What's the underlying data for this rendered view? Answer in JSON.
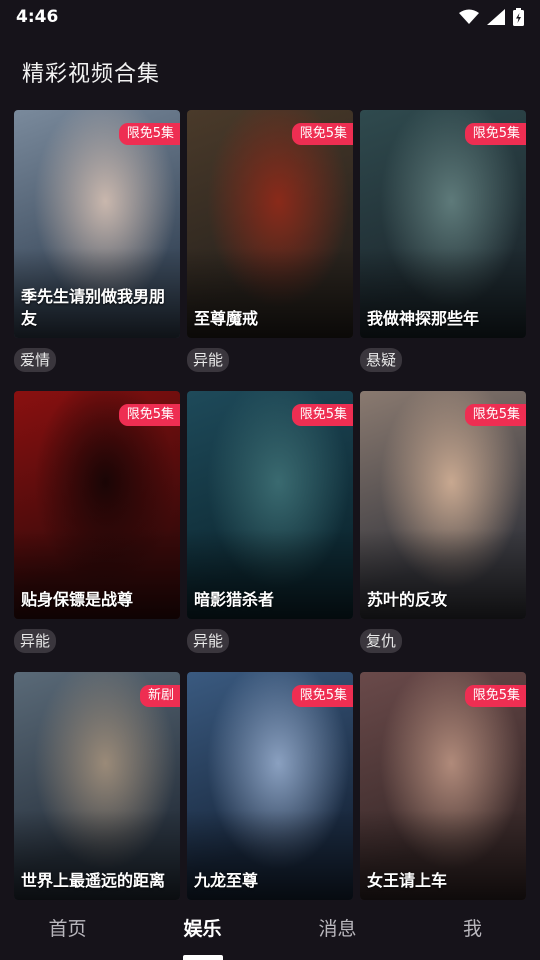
{
  "status": {
    "time": "4:46",
    "icons": [
      "wifi-icon",
      "signal-icon",
      "battery-icon"
    ]
  },
  "section": {
    "title": "精彩视频合集"
  },
  "cards": [
    {
      "title": "季先生请别做我男朋友",
      "badge": "限免5集",
      "genre": "爱情",
      "palette": [
        "#3b4a5c",
        "#7a8a9c",
        "#c9b7ad"
      ]
    },
    {
      "title": "至尊魔戒",
      "badge": "限免5集",
      "genre": "异能",
      "palette": [
        "#2a241e",
        "#4a3a2a",
        "#8a2a1a"
      ]
    },
    {
      "title": "我做神探那些年",
      "badge": "限免5集",
      "genre": "悬疑",
      "palette": [
        "#1e2a30",
        "#2f4a4e",
        "#5e7a7a"
      ]
    },
    {
      "title": "贴身保镖是战尊",
      "badge": "限免5集",
      "genre": "异能",
      "palette": [
        "#3a0a0a",
        "#8a1010",
        "#1a0505"
      ]
    },
    {
      "title": "暗影猎杀者",
      "badge": "限免5集",
      "genre": "异能",
      "palette": [
        "#0e2a34",
        "#1e4a5a",
        "#3a6a70"
      ]
    },
    {
      "title": "苏叶的反攻",
      "badge": "限免5集",
      "genre": "复仇",
      "palette": [
        "#3a3a40",
        "#8a7a70",
        "#c8a890"
      ]
    },
    {
      "title": "世界上最遥远的距离",
      "badge": "新剧",
      "genre": "",
      "palette": [
        "#2a3440",
        "#5a6a78",
        "#9a8a78"
      ]
    },
    {
      "title": "九龙至尊",
      "badge": "限免5集",
      "genre": "",
      "palette": [
        "#1a2a40",
        "#3a5a80",
        "#8aa0c0"
      ]
    },
    {
      "title": "女王请上车",
      "badge": "限免5集",
      "genre": "",
      "palette": [
        "#3a2a2a",
        "#6a4a4a",
        "#b08a7a"
      ]
    }
  ],
  "tabs": [
    {
      "label": "首页",
      "active": false
    },
    {
      "label": "娱乐",
      "active": true
    },
    {
      "label": "消息",
      "active": false
    },
    {
      "label": "我",
      "active": false
    }
  ]
}
